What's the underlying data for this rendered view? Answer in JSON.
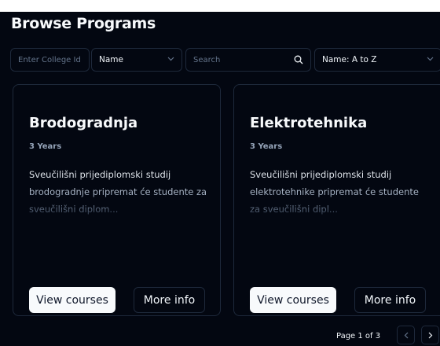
{
  "page": {
    "title": "Browse Programs"
  },
  "filters": {
    "college_placeholder": "Enter College Id",
    "name_select": "Name",
    "search_placeholder": "Search",
    "sort_select": "Name: A to Z"
  },
  "programs": [
    {
      "title": "Brodogradnja",
      "duration": "3 Years",
      "description": "Sveučilišni prijediplomski studij brodogradnje pripremat će studente za sveučilišni diplom...",
      "view_label": "View courses",
      "info_label": "More info"
    },
    {
      "title": "Elektrotehnika",
      "duration": "3 Years",
      "description": "Sveučilišni prijediplomski studij elektrotehnike pripremat će studente za sveučilišni dipl...",
      "view_label": "View courses",
      "info_label": "More info"
    }
  ],
  "pagination": {
    "label": "Page 1 of 3",
    "prev_icon": "chevron-left-icon",
    "next_icon": "chevron-right-icon"
  },
  "colors": {
    "background": "#030711",
    "border": "#1e293b",
    "primary_button": "#f8fafc"
  }
}
